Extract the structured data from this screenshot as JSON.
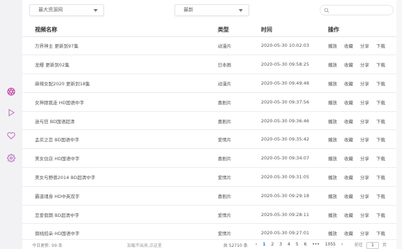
{
  "toolbar": {
    "source_select": "最大资源网",
    "sort_select": "最新",
    "search_placeholder": ""
  },
  "table": {
    "headers": {
      "name": "视频名称",
      "type": "类型",
      "time": "时间",
      "action": "操作"
    },
    "actions": {
      "play": "播放",
      "favorite": "收藏",
      "share": "分享",
      "download": "下载"
    },
    "rows": [
      {
        "name": "万界神主 更新到97集",
        "type": "动漫片",
        "time": "2020-05-30 10:02:03"
      },
      {
        "name": "龙樱 更新到02集",
        "type": "日本剧",
        "time": "2020-05-30 09:58:25"
      },
      {
        "name": "麻辣女配2020 更新到18集",
        "type": "动漫片",
        "time": "2020-05-30 09:49:48"
      },
      {
        "name": "女神跟我走 HD国语中字",
        "type": "喜剧片",
        "time": "2020-05-30 09:37:56"
      },
      {
        "name": "迷与狂 BD国语超清",
        "type": "喜剧片",
        "time": "2020-05-30 09:36:46"
      },
      {
        "name": "孟买之恋 BD国语中字",
        "type": "爱情片",
        "time": "2020-05-30 09:35:42"
      },
      {
        "name": "美女住店 HD国语中字",
        "type": "喜剧片",
        "time": "2020-05-30 09:34:07"
      },
      {
        "name": "美女与野兽2014 BD超清中字",
        "type": "爱情片",
        "time": "2020-05-30 09:31:05"
      },
      {
        "name": "霸道魂身 HD中英双字",
        "type": "喜剧片",
        "time": "2020-05-30 09:29:18"
      },
      {
        "name": "恋爱假期 BD超清中字",
        "type": "爱情片",
        "time": "2020-05-30 09:28:11"
      },
      {
        "name": "倒桃招朵 HD国语中字",
        "type": "爱情片",
        "time": "2020-05-30 09:27:01"
      }
    ]
  },
  "footer": {
    "today_updates": "今日更新: 99 条",
    "hint": "加载不出来,点这里",
    "total": "共 52710 条",
    "prev": "‹",
    "pages": [
      "1",
      "2",
      "3",
      "4",
      "5",
      "6",
      "•••",
      "1055"
    ],
    "next": "›",
    "goto_label": "前往",
    "goto_value": "1",
    "page_unit": "页"
  },
  "colors": {
    "accent_icon": "#c0399e",
    "active_page": "#2f6df0",
    "notification_dot": "#f07b6b"
  },
  "sidebar_icons": [
    "aperture-icon",
    "play-icon",
    "heart-icon",
    "settings-icon"
  ]
}
